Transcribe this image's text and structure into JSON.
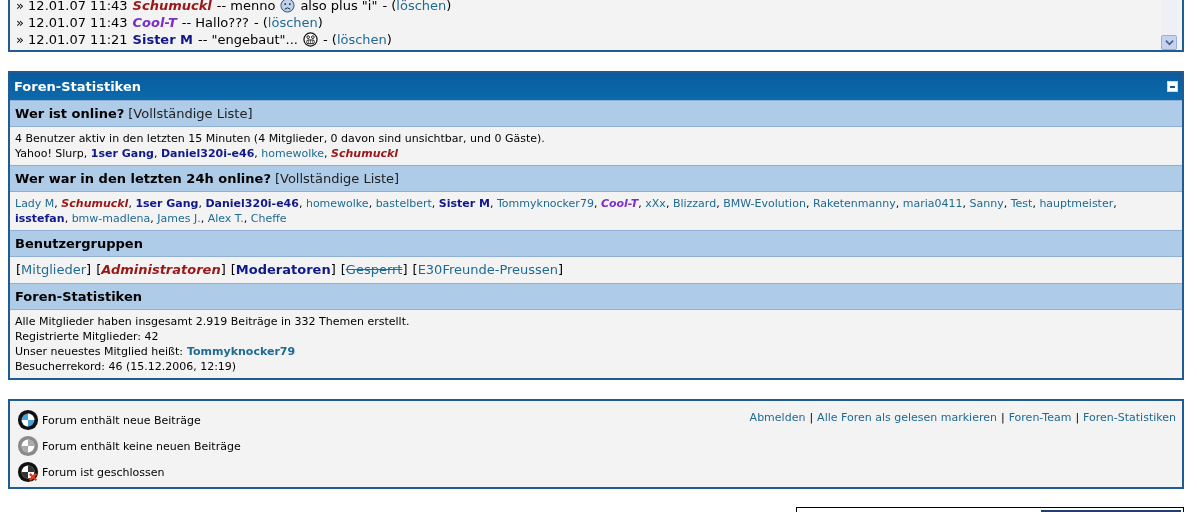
{
  "shoutbox": {
    "bullet": "»",
    "delete_open": "- (",
    "delete_close": ")",
    "entries": [
      {
        "time": "12.01.07 11:43",
        "user": {
          "name": "Schumuckl",
          "kind": "admin"
        },
        "message": "-- menno",
        "smiley": {
          "kind": "sad"
        },
        "message_after": "also plus \"i\"",
        "delete": "löschen"
      },
      {
        "time": "12.01.07 11:43",
        "user": {
          "name": "Cool-T",
          "kind": "cool"
        },
        "message": "-- Hallo???",
        "delete": "löschen"
      },
      {
        "time": "12.01.07 11:21",
        "user": {
          "name": "Sister M",
          "kind": "mod"
        },
        "message": "-- \"engebaut\"...",
        "smiley": {
          "kind": "grin"
        },
        "delete": "löschen"
      }
    ]
  },
  "stats": {
    "title": "Foren-Statistiken",
    "separator": ", ",
    "brackets": [
      "[",
      "]"
    ],
    "online": {
      "heading": "Wer ist online?",
      "link": "[Vollständige Liste]",
      "summary": "4 Benutzer aktiv in den letzten 15 Minuten (4 Mitglieder, 0 davon sind unsichtbar, und 0 Gäste).",
      "users": [
        {
          "name": "Yahoo! Slurp",
          "kind": "bot"
        },
        {
          "name": "1ser Gang",
          "kind": "mod"
        },
        {
          "name": "Daniel320i-e46",
          "kind": "mod"
        },
        {
          "name": "homewolke",
          "kind": "member"
        },
        {
          "name": "Schumuckl",
          "kind": "admin"
        }
      ]
    },
    "last24": {
      "heading": "Wer war in den letzten 24h online?",
      "link": "[Vollständige Liste]",
      "users": [
        {
          "name": "Lady M",
          "kind": "member"
        },
        {
          "name": "Schumuckl",
          "kind": "admin"
        },
        {
          "name": "1ser Gang",
          "kind": "mod"
        },
        {
          "name": "Daniel320i-e46",
          "kind": "mod"
        },
        {
          "name": "homewolke",
          "kind": "member"
        },
        {
          "name": "bastelbert",
          "kind": "member"
        },
        {
          "name": "Sister M",
          "kind": "mod"
        },
        {
          "name": "Tommyknocker79",
          "kind": "member"
        },
        {
          "name": "Cool-T",
          "kind": "cool"
        },
        {
          "name": "xXx",
          "kind": "member"
        },
        {
          "name": "Blizzard",
          "kind": "member"
        },
        {
          "name": "BMW-Evolution",
          "kind": "member"
        },
        {
          "name": "Raketenmanny",
          "kind": "member"
        },
        {
          "name": "maria0411",
          "kind": "member"
        },
        {
          "name": "Sanny",
          "kind": "member"
        },
        {
          "name": "Test",
          "kind": "member"
        },
        {
          "name": "hauptmeister",
          "kind": "member"
        },
        {
          "name": "isstefan",
          "kind": "mod"
        },
        {
          "name": "bmw-madlena",
          "kind": "member"
        },
        {
          "name": "James J.",
          "kind": "member"
        },
        {
          "name": "Alex T.",
          "kind": "member"
        },
        {
          "name": "Cheffe",
          "kind": "member"
        }
      ]
    },
    "groups": {
      "heading": "Benutzergruppen",
      "items": [
        {
          "name": "Mitglieder",
          "kind": "member"
        },
        {
          "name": "Administratoren",
          "kind": "admin"
        },
        {
          "name": "Moderatoren",
          "kind": "mod"
        },
        {
          "name": "Gesperrt",
          "kind": "banned"
        },
        {
          "name": "E30Freunde-Preussen",
          "kind": "member"
        }
      ]
    },
    "forum_stats": {
      "heading": "Foren-Statistiken",
      "lines": [
        "Alle Mitglieder haben insgesamt 2.919 Beiträge in 332 Themen erstellt.",
        "Registrierte Mitglieder: 42"
      ],
      "newest_label": "Unser neuestes Mitglied heißt:",
      "newest_member": "Tommyknocker79",
      "record": "Besucherrekord: 46 (15.12.2006, 12:19)"
    }
  },
  "legend": {
    "items": [
      {
        "kind": "new",
        "label": "Forum enthält neue Beiträge"
      },
      {
        "kind": "none",
        "label": "Forum enthält keine neuen Beiträge"
      },
      {
        "kind": "locked",
        "label": "Forum ist geschlossen"
      }
    ],
    "separator": "|",
    "links": [
      "Abmelden",
      "Alle Foren als gelesen markieren",
      "Foren-Team",
      "Foren-Statistiken"
    ]
  }
}
